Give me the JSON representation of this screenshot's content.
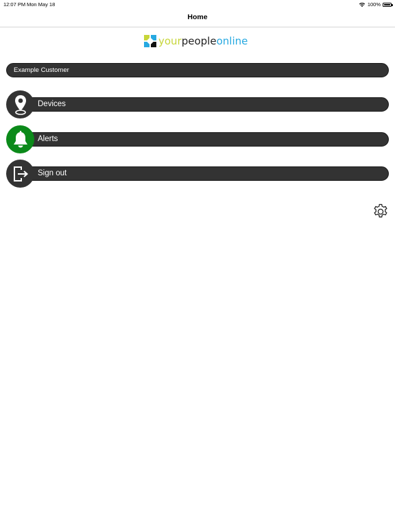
{
  "status_bar": {
    "time": "12:07 PM",
    "date": "Mon May 18",
    "battery": "100%"
  },
  "nav": {
    "title": "Home"
  },
  "logo": {
    "part1": "your",
    "part2": "people",
    "part3": "online"
  },
  "customer": {
    "name": "Example Customer"
  },
  "menu": [
    {
      "label": "Devices",
      "icon": "location-pin-icon"
    },
    {
      "label": "Alerts",
      "icon": "bell-icon"
    },
    {
      "label": "Sign out",
      "icon": "sign-out-icon"
    }
  ],
  "colors": {
    "bar": "#333333",
    "active_green": "#0b8a1a",
    "logo_your": "#c7d63a",
    "logo_people": "#222222",
    "logo_online": "#27a9e1"
  }
}
